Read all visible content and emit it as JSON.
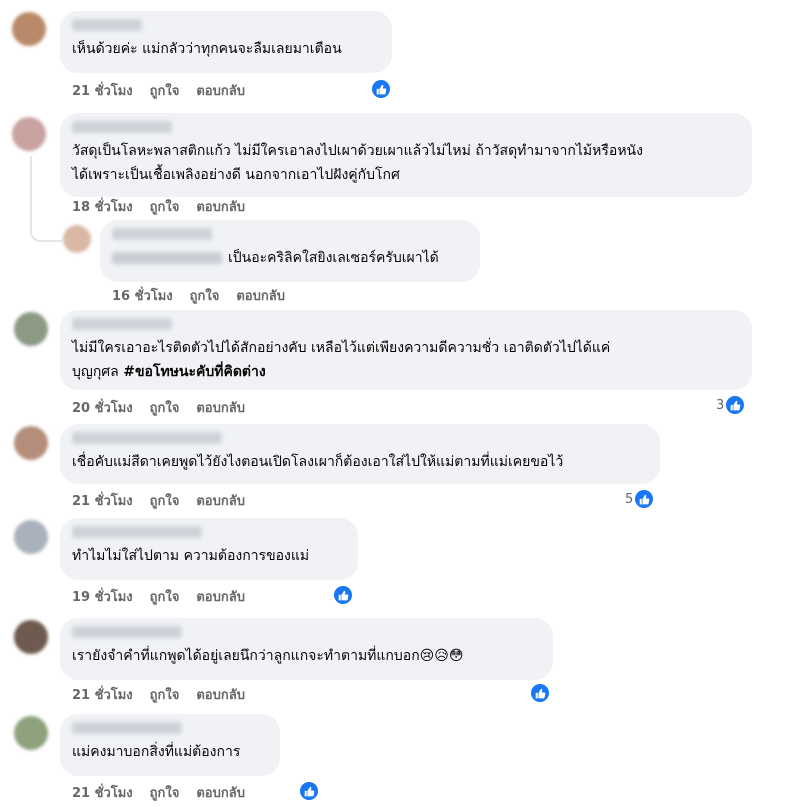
{
  "comments": [
    {
      "text": "เห็นด้วยค่ะ แม่กลัวว่าทุกคนจะลืมเลยมาเตือน",
      "time": "21 ชั่วโมง",
      "like": "ถูกใจ",
      "reply": "ตอบกลับ",
      "reaction_count": ""
    },
    {
      "text": "วัสดุเป็นโลหะพลาสติกแก้ว ไม่มีใครเอาลงไปเผาด้วยเผาแล้วไม่ไหม่ ถ้าวัสดุทำมาจากไม้หรือหนัง\nได้เพราะเป็นเชื้อเพลิงอย่างดี นอกจากเอาไปฝังคู่กับโกศ",
      "time": "18 ชั่วโมง",
      "like": "ถูกใจ",
      "reply": "ตอบกลับ"
    },
    {
      "text": "เป็นอะคริลิคใสยิงเลเซอร์ครับเผาได้",
      "time": "16 ชั่วโมง",
      "like": "ถูกใจ",
      "reply": "ตอบกลับ"
    },
    {
      "text": "ไม่มีใครเอาอะไรติดตัวไปได้สักอย่างคับ เหลือไว้แต่เพียงความดีความชั่ว เอาติดตัวไปได้แค่",
      "text2": "บุญกุศล ",
      "hashtag": "#ขอโทษนะคับที่คิดต่าง",
      "time": "20 ชั่วโมง",
      "like": "ถูกใจ",
      "reply": "ตอบกลับ",
      "reaction_count": "3"
    },
    {
      "text": "เชื่อคับแม่สีดาเคยพูดไว้ยังไงตอนเปิดโลงเผาก็ต้องเอาใส่ไปให้แม่ตามที่แม่เคยขอไว้",
      "time": "21 ชั่วโมง",
      "like": "ถูกใจ",
      "reply": "ตอบกลับ",
      "reaction_count": "5"
    },
    {
      "text": "ทำไมไม่ใส่ไปตาม ความต้องการของแม่",
      "time": "19 ชั่วโมง",
      "like": "ถูกใจ",
      "reply": "ตอบกลับ"
    },
    {
      "text": "เรายังจำคำที่แกพูดได้อยู่เลยนึกว่าลูกแกจะทำตามที่แกบอก😢😥😳",
      "time": "21 ชั่วโมง",
      "like": "ถูกใจ",
      "reply": "ตอบกลับ"
    },
    {
      "text": "แม่คงมาบอกสิ่งที่แม่ต้องการ",
      "time": "21 ชั่วโมง",
      "like": "ถูกใจ",
      "reply": "ตอบกลับ"
    }
  ],
  "colors": {
    "bubble": "#f0f2f5",
    "meta_text": "#65676b",
    "like_blue": "#1877f2"
  },
  "icons": {
    "reaction": "like-thumbs-up-icon"
  }
}
